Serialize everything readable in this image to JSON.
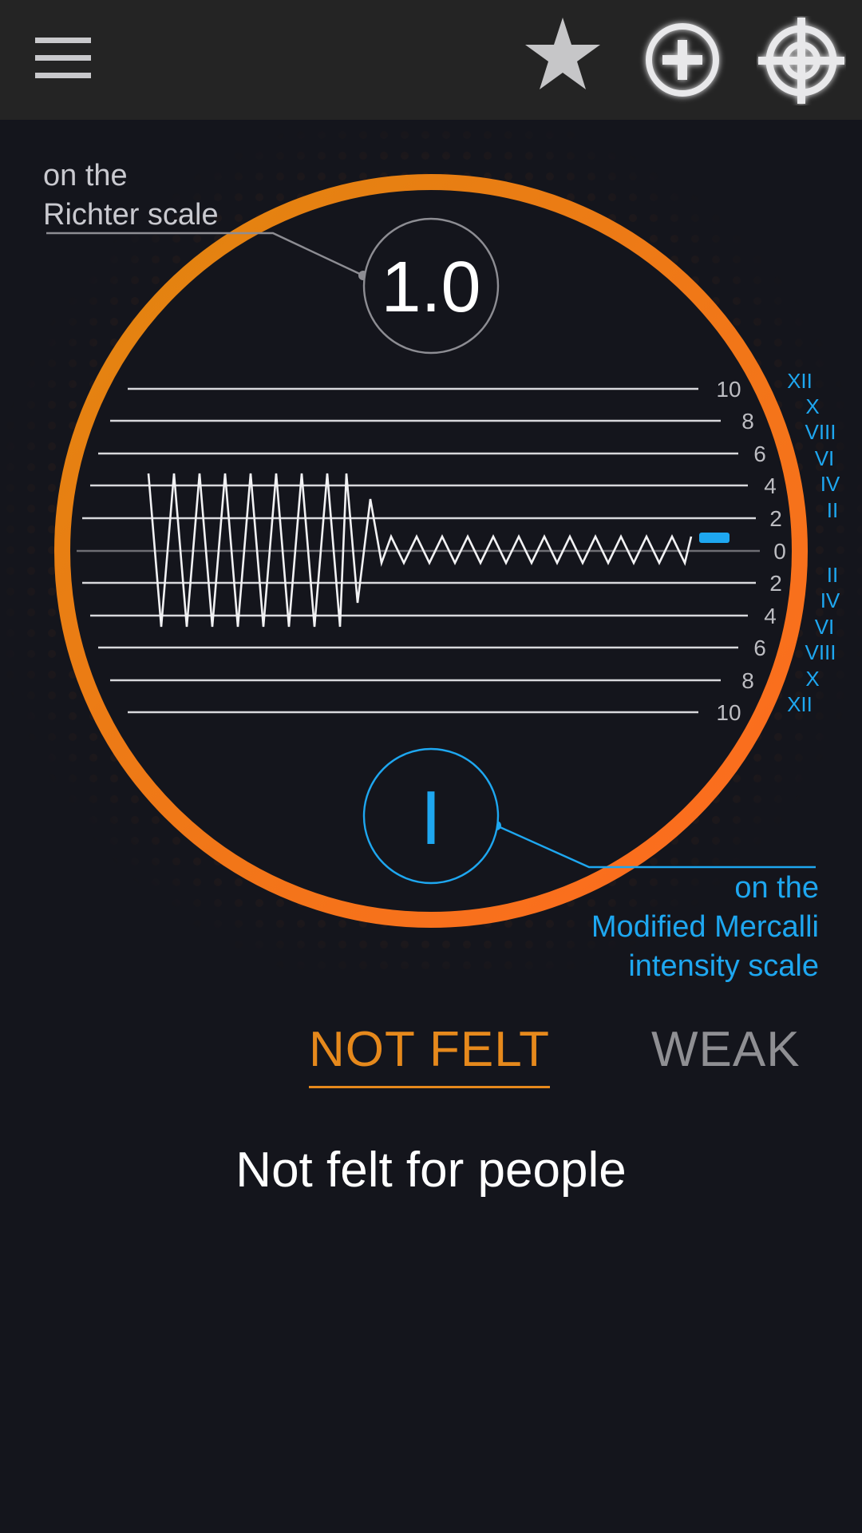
{
  "toolbar": {
    "menu_icon": "hamburger-menu-icon",
    "favorite_icon": "star-icon",
    "add_icon": "plus-circle-icon",
    "locate_icon": "crosshair-target-icon"
  },
  "richter": {
    "label_line1": "on the",
    "label_line2": "Richter scale",
    "value": "1.0"
  },
  "mercalli": {
    "label_line1": "on the",
    "label_line2": "Modified Mercalli",
    "label_line3": "intensity scale",
    "value": "I"
  },
  "scale": {
    "numbers": [
      "10",
      "8",
      "6",
      "4",
      "2",
      "0",
      "2",
      "4",
      "6",
      "8",
      "10"
    ],
    "roman": [
      "XII",
      "X",
      "VIII",
      "VI",
      "IV",
      "II",
      "",
      "II",
      "IV",
      "VI",
      "VIII",
      "X",
      "XII"
    ],
    "roman_upper": [
      "XII",
      "X",
      "VIII",
      "VI",
      "IV",
      "II"
    ],
    "roman_lower": [
      "II",
      "IV",
      "VI",
      "VIII",
      "X",
      "XII"
    ]
  },
  "tabs": {
    "active": "NOT FELT",
    "next": "WEAK"
  },
  "description": "Not felt for people",
  "colors": {
    "background": "#14151c",
    "toolbar": "#242424",
    "accent_orange": "#e6891c",
    "accent_blue": "#1ea7f0",
    "inactive_tab": "#8f8f93"
  }
}
